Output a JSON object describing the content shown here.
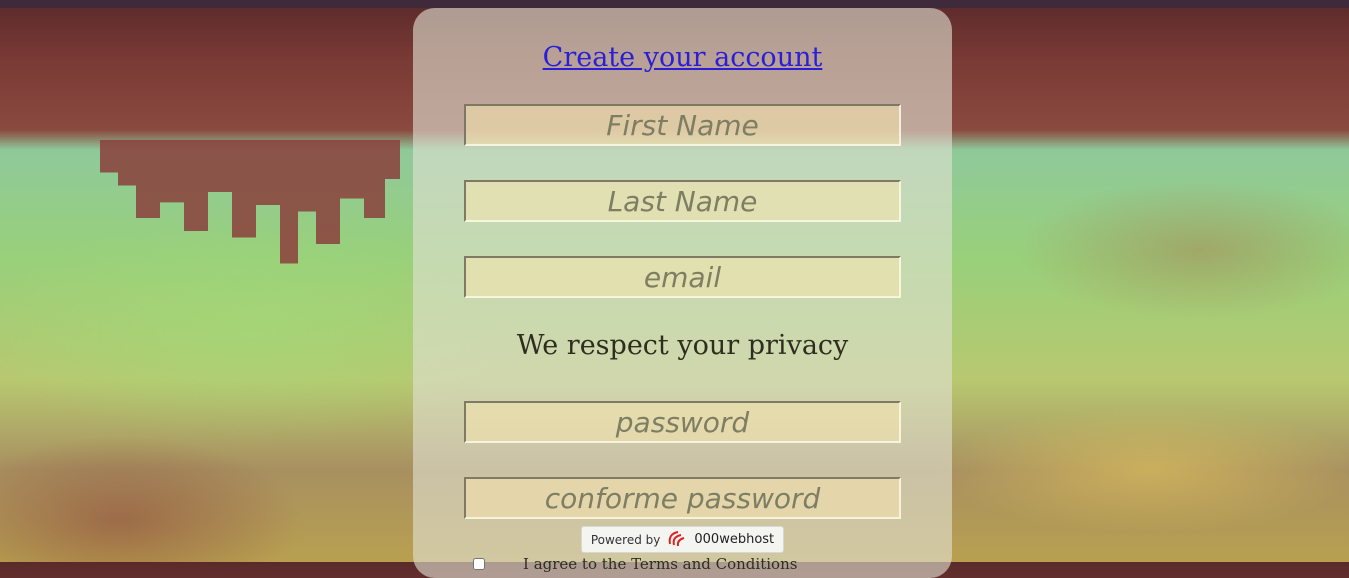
{
  "form": {
    "title": "Create your account",
    "first_name_placeholder": "First Name",
    "last_name_placeholder": "Last Name",
    "email_placeholder": "email",
    "privacy_text": "We respect your privacy",
    "password_placeholder": "password",
    "confirm_password_placeholder": "conforme password",
    "terms_label": "I agree to the Terms and Conditions"
  },
  "badge": {
    "powered_by": "Powered by",
    "brand": "000webhost",
    "icon": "000webhost-logo-icon"
  },
  "colors": {
    "title_link": "#2b1fd6",
    "placeholder": "#7d7e63",
    "card_background": "rgba(225,225,210,0.62)"
  }
}
